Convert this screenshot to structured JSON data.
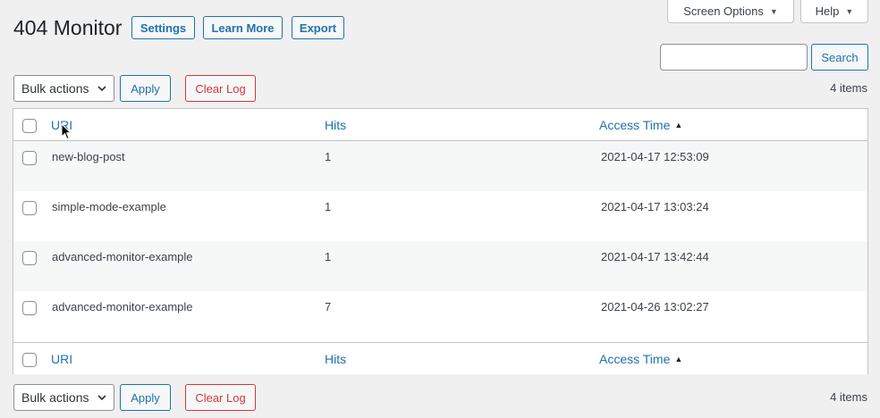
{
  "screen_meta": {
    "screen_options_label": "Screen Options",
    "help_label": "Help"
  },
  "header": {
    "title": "404 Monitor",
    "buttons": [
      "Settings",
      "Learn More",
      "Export"
    ]
  },
  "search": {
    "value": "",
    "button_label": "Search"
  },
  "tablenav_top": {
    "bulk_actions_label": "Bulk actions",
    "apply_label": "Apply",
    "clear_log_label": "Clear Log",
    "items_count": "4 items"
  },
  "table": {
    "columns": {
      "uri": "URI",
      "hits": "Hits",
      "access_time": "Access Time"
    },
    "sorted_column": "access_time",
    "sort_direction": "ascending",
    "rows": [
      {
        "uri": "new-blog-post",
        "hits": "1",
        "access_time": "2021-04-17 12:53:09"
      },
      {
        "uri": "simple-mode-example",
        "hits": "1",
        "access_time": "2021-04-17 13:03:24"
      },
      {
        "uri": "advanced-monitor-example",
        "hits": "1",
        "access_time": "2021-04-17 13:42:44"
      },
      {
        "uri": "advanced-monitor-example",
        "hits": "7",
        "access_time": "2021-04-26 13:02:27"
      }
    ]
  },
  "tablenav_bottom": {
    "bulk_actions_label": "Bulk actions",
    "apply_label": "Apply",
    "clear_log_label": "Clear Log",
    "items_count": "4 items"
  },
  "colors": {
    "accent": "#2271b1",
    "danger": "#d63638",
    "background": "#f0f0f1"
  },
  "icons": {
    "sort_indicator": "triangle-up-icon",
    "dropdown": "chevron-down-icon",
    "pointer": "mouse-cursor-icon"
  }
}
